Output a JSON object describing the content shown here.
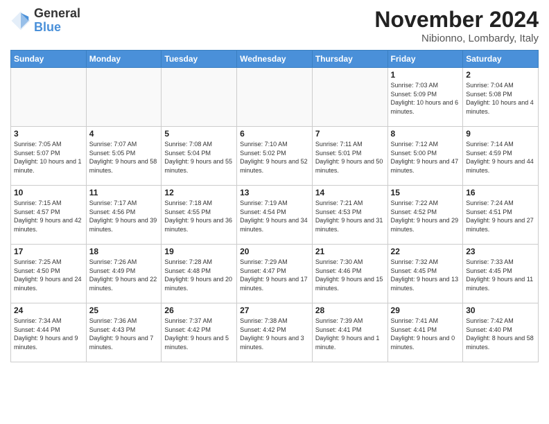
{
  "logo": {
    "line1": "General",
    "line2": "Blue"
  },
  "title": "November 2024",
  "location": "Nibionno, Lombardy, Italy",
  "days_of_week": [
    "Sunday",
    "Monday",
    "Tuesday",
    "Wednesday",
    "Thursday",
    "Friday",
    "Saturday"
  ],
  "weeks": [
    [
      {
        "day": "",
        "info": ""
      },
      {
        "day": "",
        "info": ""
      },
      {
        "day": "",
        "info": ""
      },
      {
        "day": "",
        "info": ""
      },
      {
        "day": "",
        "info": ""
      },
      {
        "day": "1",
        "info": "Sunrise: 7:03 AM\nSunset: 5:09 PM\nDaylight: 10 hours\nand 6 minutes."
      },
      {
        "day": "2",
        "info": "Sunrise: 7:04 AM\nSunset: 5:08 PM\nDaylight: 10 hours\nand 4 minutes."
      }
    ],
    [
      {
        "day": "3",
        "info": "Sunrise: 7:05 AM\nSunset: 5:07 PM\nDaylight: 10 hours\nand 1 minute."
      },
      {
        "day": "4",
        "info": "Sunrise: 7:07 AM\nSunset: 5:05 PM\nDaylight: 9 hours\nand 58 minutes."
      },
      {
        "day": "5",
        "info": "Sunrise: 7:08 AM\nSunset: 5:04 PM\nDaylight: 9 hours\nand 55 minutes."
      },
      {
        "day": "6",
        "info": "Sunrise: 7:10 AM\nSunset: 5:02 PM\nDaylight: 9 hours\nand 52 minutes."
      },
      {
        "day": "7",
        "info": "Sunrise: 7:11 AM\nSunset: 5:01 PM\nDaylight: 9 hours\nand 50 minutes."
      },
      {
        "day": "8",
        "info": "Sunrise: 7:12 AM\nSunset: 5:00 PM\nDaylight: 9 hours\nand 47 minutes."
      },
      {
        "day": "9",
        "info": "Sunrise: 7:14 AM\nSunset: 4:59 PM\nDaylight: 9 hours\nand 44 minutes."
      }
    ],
    [
      {
        "day": "10",
        "info": "Sunrise: 7:15 AM\nSunset: 4:57 PM\nDaylight: 9 hours\nand 42 minutes."
      },
      {
        "day": "11",
        "info": "Sunrise: 7:17 AM\nSunset: 4:56 PM\nDaylight: 9 hours\nand 39 minutes."
      },
      {
        "day": "12",
        "info": "Sunrise: 7:18 AM\nSunset: 4:55 PM\nDaylight: 9 hours\nand 36 minutes."
      },
      {
        "day": "13",
        "info": "Sunrise: 7:19 AM\nSunset: 4:54 PM\nDaylight: 9 hours\nand 34 minutes."
      },
      {
        "day": "14",
        "info": "Sunrise: 7:21 AM\nSunset: 4:53 PM\nDaylight: 9 hours\nand 31 minutes."
      },
      {
        "day": "15",
        "info": "Sunrise: 7:22 AM\nSunset: 4:52 PM\nDaylight: 9 hours\nand 29 minutes."
      },
      {
        "day": "16",
        "info": "Sunrise: 7:24 AM\nSunset: 4:51 PM\nDaylight: 9 hours\nand 27 minutes."
      }
    ],
    [
      {
        "day": "17",
        "info": "Sunrise: 7:25 AM\nSunset: 4:50 PM\nDaylight: 9 hours\nand 24 minutes."
      },
      {
        "day": "18",
        "info": "Sunrise: 7:26 AM\nSunset: 4:49 PM\nDaylight: 9 hours\nand 22 minutes."
      },
      {
        "day": "19",
        "info": "Sunrise: 7:28 AM\nSunset: 4:48 PM\nDaylight: 9 hours\nand 20 minutes."
      },
      {
        "day": "20",
        "info": "Sunrise: 7:29 AM\nSunset: 4:47 PM\nDaylight: 9 hours\nand 17 minutes."
      },
      {
        "day": "21",
        "info": "Sunrise: 7:30 AM\nSunset: 4:46 PM\nDaylight: 9 hours\nand 15 minutes."
      },
      {
        "day": "22",
        "info": "Sunrise: 7:32 AM\nSunset: 4:45 PM\nDaylight: 9 hours\nand 13 minutes."
      },
      {
        "day": "23",
        "info": "Sunrise: 7:33 AM\nSunset: 4:45 PM\nDaylight: 9 hours\nand 11 minutes."
      }
    ],
    [
      {
        "day": "24",
        "info": "Sunrise: 7:34 AM\nSunset: 4:44 PM\nDaylight: 9 hours\nand 9 minutes."
      },
      {
        "day": "25",
        "info": "Sunrise: 7:36 AM\nSunset: 4:43 PM\nDaylight: 9 hours\nand 7 minutes."
      },
      {
        "day": "26",
        "info": "Sunrise: 7:37 AM\nSunset: 4:42 PM\nDaylight: 9 hours\nand 5 minutes."
      },
      {
        "day": "27",
        "info": "Sunrise: 7:38 AM\nSunset: 4:42 PM\nDaylight: 9 hours\nand 3 minutes."
      },
      {
        "day": "28",
        "info": "Sunrise: 7:39 AM\nSunset: 4:41 PM\nDaylight: 9 hours\nand 1 minute."
      },
      {
        "day": "29",
        "info": "Sunrise: 7:41 AM\nSunset: 4:41 PM\nDaylight: 9 hours\nand 0 minutes."
      },
      {
        "day": "30",
        "info": "Sunrise: 7:42 AM\nSunset: 4:40 PM\nDaylight: 8 hours\nand 58 minutes."
      }
    ]
  ]
}
